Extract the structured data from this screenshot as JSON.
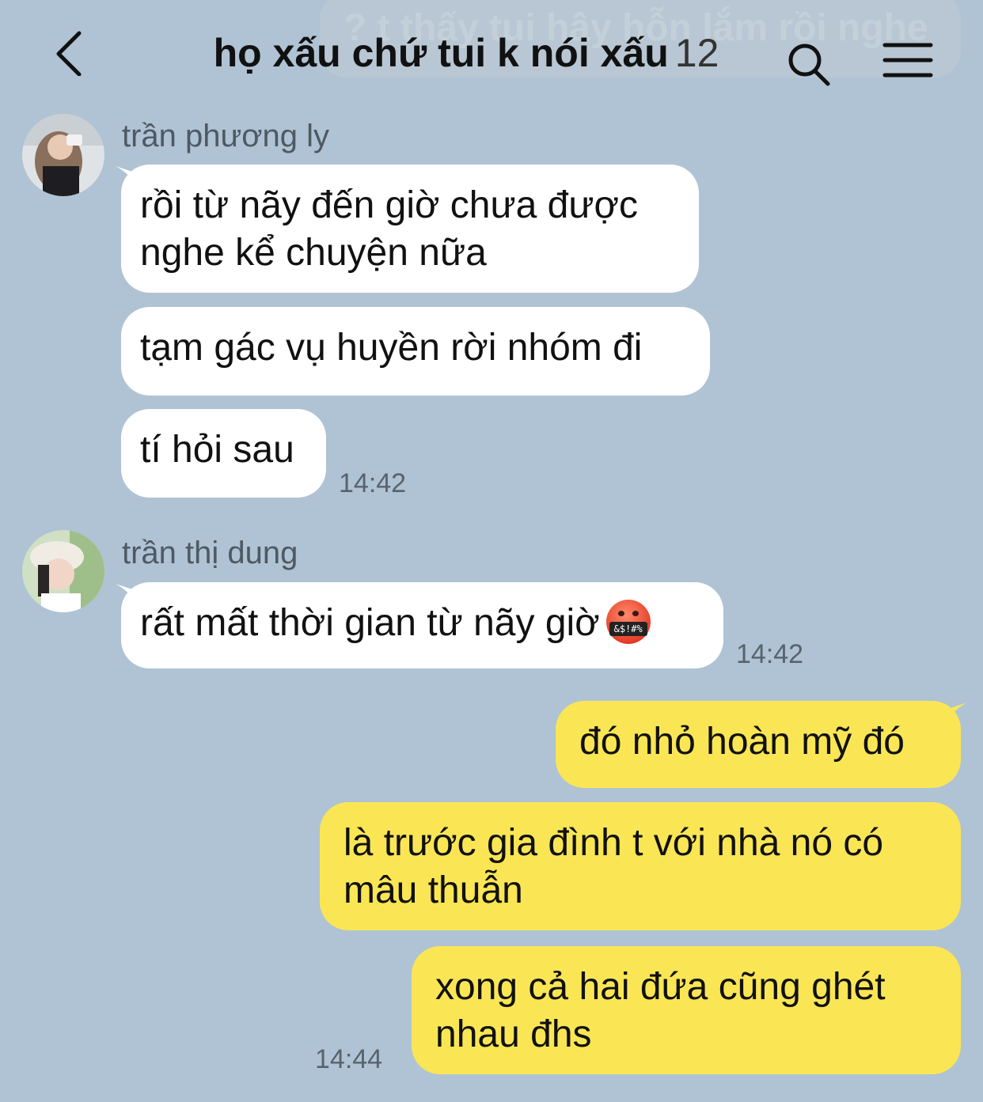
{
  "header": {
    "ghost_text": "? t thấy tui hây hỗn lắm rồi nghe",
    "title": "họ xấu chứ tui k nói xấu",
    "member_count": "12"
  },
  "messages": {
    "m1": {
      "sender": "trần phương ly",
      "b1": "rồi từ nãy đến giờ chưa được nghe kể chuyện nữa",
      "b2": "tạm gác vụ huyền rời nhóm đi",
      "b3": "tí hỏi sau",
      "time": "14:42"
    },
    "m2": {
      "sender": "trần thị dung",
      "b1": "rất mất thời gian từ nãy giờ",
      "emoji_symbols": "&$!#%",
      "time": "14:42"
    },
    "m3": {
      "b1": "đó nhỏ hoàn mỹ đó",
      "b2": "là trước gia đình t với nhà nó có mâu thuẫn",
      "b3": "xong cả hai đứa cũng ghét nhau đhs",
      "time": "14:44"
    }
  },
  "colors": {
    "background": "#afc3d4",
    "incoming_bubble": "#ffffff",
    "outgoing_bubble": "#fae654"
  }
}
